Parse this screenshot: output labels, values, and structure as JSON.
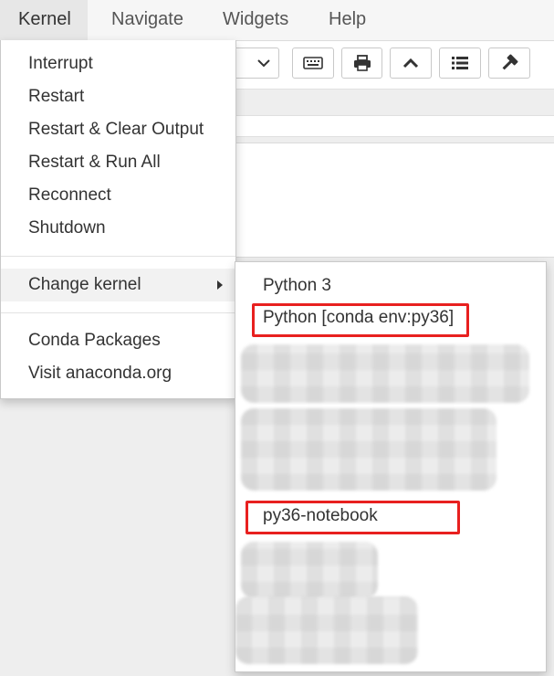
{
  "menubar": {
    "items": [
      {
        "label": "Kernel"
      },
      {
        "label": "Navigate"
      },
      {
        "label": "Widgets"
      },
      {
        "label": "Help"
      }
    ]
  },
  "toolbar": {
    "buttons": [
      {
        "icon": "keyboard-icon"
      },
      {
        "icon": "print-icon"
      },
      {
        "icon": "chevron-up-icon"
      },
      {
        "icon": "list-icon"
      },
      {
        "icon": "hammer-icon"
      }
    ]
  },
  "kernel_menu": {
    "items": [
      {
        "label": "Interrupt"
      },
      {
        "label": "Restart"
      },
      {
        "label": "Restart & Clear Output"
      },
      {
        "label": "Restart & Run All"
      },
      {
        "label": "Reconnect"
      },
      {
        "label": "Shutdown"
      }
    ],
    "change_kernel": {
      "label": "Change kernel"
    },
    "extra_items": [
      {
        "label": "Conda Packages"
      },
      {
        "label": "Visit anaconda.org"
      }
    ]
  },
  "kernel_submenu": {
    "items": [
      {
        "label": "Python 3"
      },
      {
        "label": "Python [conda env:py36]"
      },
      {
        "label": "py36-notebook"
      }
    ]
  },
  "colors": {
    "highlight": "#e8201f",
    "menu_hover": "#f2f2f2"
  }
}
